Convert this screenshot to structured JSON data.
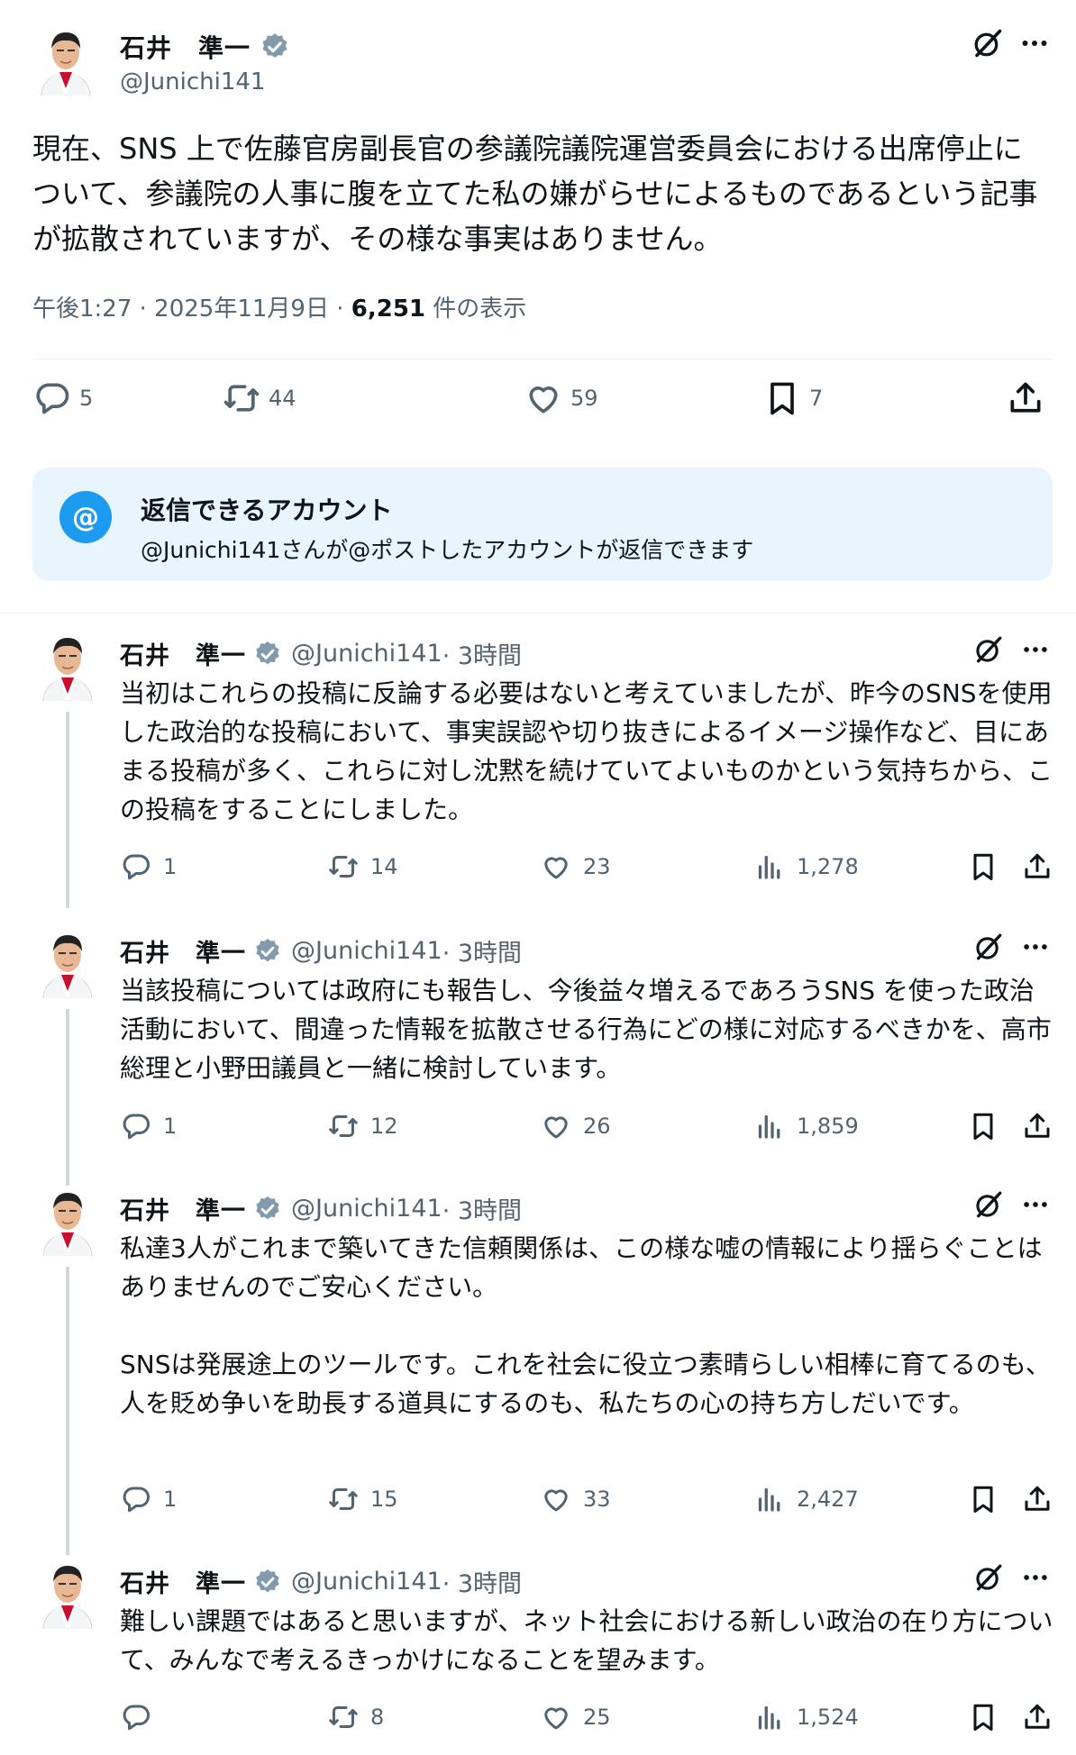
{
  "main_tweet": {
    "name": "石井　準一",
    "handle": "@Junichi141",
    "text": "現在、SNS 上で佐藤官房副長官の参議院議院運営委員会における出席停止について、参議院の人事に腹を立てた私の嫌がらせによるものであるという記事が拡散されていますが、その様な事実はありません。",
    "time": "午後1:27 · 2025年11月9日 · ",
    "views": "6,251",
    "views_label": " 件の表示",
    "replies": "5",
    "reposts": "44",
    "likes": "59",
    "bookmarks": "7"
  },
  "reply_settings": {
    "title": "返信できるアカウント",
    "description": "@Junichi141さんが@ポストしたアカウントが返信できます"
  },
  "replies": [
    {
      "name": "石井　準一",
      "handle": "@Junichi141",
      "time": " · 3時間",
      "text": "当初はこれらの投稿に反論する必要はないと考えていましたが、昨今のSNSを使用した政治的な投稿において、事実誤認や切り抜きによるイメージ操作など、目にあまる投稿が多く、これらに対し沈黙を続けていてよいものかという気持ちから、この投稿をすることにしました。",
      "replies": "1",
      "reposts": "14",
      "likes": "23",
      "views": "1,278"
    },
    {
      "name": "石井　準一",
      "handle": "@Junichi141",
      "time": " · 3時間",
      "text": "当該投稿については政府にも報告し、今後益々増えるであろうSNS を使った政治活動において、間違った情報を拡散させる行為にどの様に対応するべきかを、高市総理と小野田議員と一緒に検討しています。",
      "replies": "1",
      "reposts": "12",
      "likes": "26",
      "views": "1,859"
    },
    {
      "name": "石井　準一",
      "handle": "@Junichi141",
      "time": " · 3時間",
      "text": "私達3人がこれまで築いてきた信頼関係は、この様な嘘の情報により揺らぐことはありませんのでご安心ください。\n\nSNSは発展途上のツールです。これを社会に役立つ素晴らしい相棒に育てるのも、人を貶め争いを助長する道具にするのも、私たちの心の持ち方しだいです。",
      "replies": "1",
      "reposts": "15",
      "likes": "33",
      "views": "2,427"
    },
    {
      "name": "石井　準一",
      "handle": "@Junichi141",
      "time": " · 3時間",
      "text": "難しい課題ではあると思いますが、ネット社会における新しい政治の在り方について、みんなで考えるきっかけになることを望みます。",
      "replies": "",
      "reposts": "8",
      "likes": "25",
      "views": "1,524"
    }
  ],
  "colors": {
    "text": "#0f1419",
    "secondary": "#536471",
    "verified": "#829aab",
    "accent": "#1d9bf0",
    "reply_box_bg": "#e8f5fd",
    "thread_line": "#cfd9de"
  },
  "icons": [
    "verified-badge-icon",
    "grok-icon",
    "more-icon",
    "reply-icon",
    "repost-icon",
    "like-icon",
    "bookmark-icon",
    "share-icon",
    "views-icon",
    "at-icon"
  ]
}
